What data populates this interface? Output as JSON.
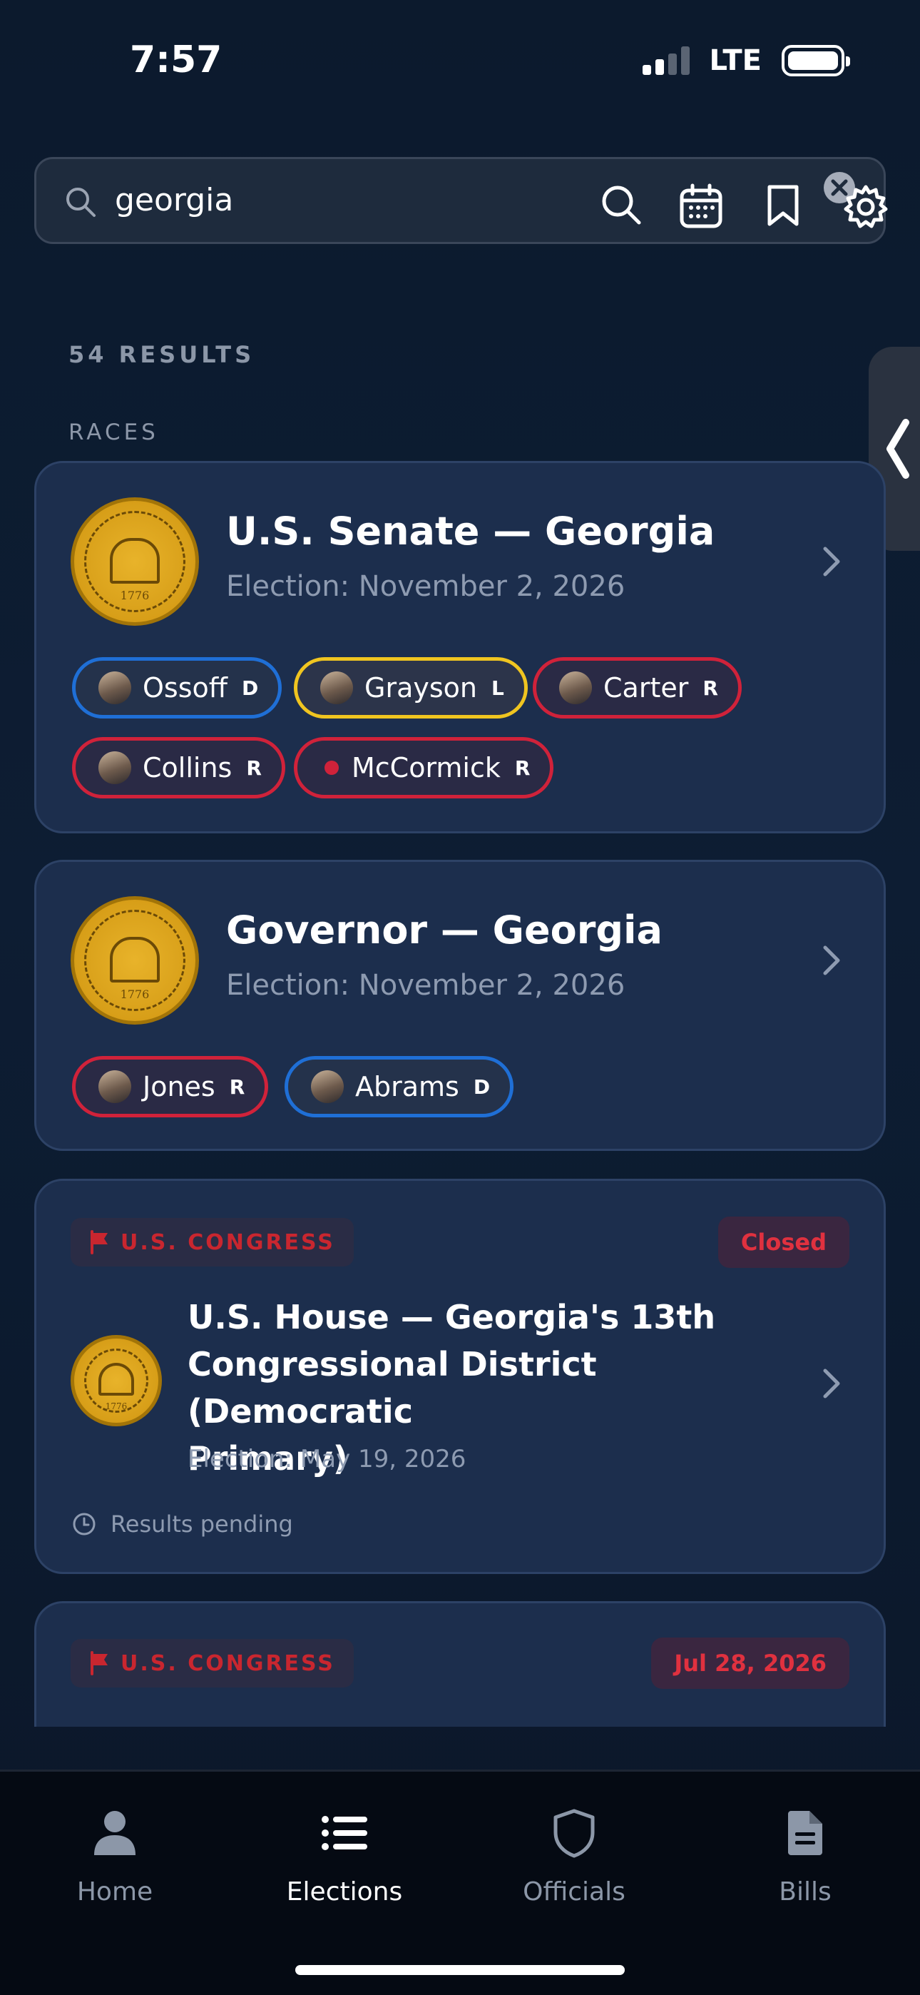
{
  "status": {
    "time": "7:57",
    "network": "LTE"
  },
  "search": {
    "value": "georgia"
  },
  "results": {
    "count_label": "54 RESULTS",
    "section_label": "RACES"
  },
  "cards": [
    {
      "title": "U.S. Senate — Georgia",
      "subtitle": "Election: November 2, 2026",
      "candidates": [
        {
          "name": "Ossoff",
          "party": "D"
        },
        {
          "name": "Grayson",
          "party": "L"
        },
        {
          "name": "Carter",
          "party": "R"
        },
        {
          "name": "Collins",
          "party": "R"
        },
        {
          "name": "McCormick",
          "party": "R"
        }
      ],
      "seal_year": "1776"
    },
    {
      "title": "Governor — Georgia",
      "subtitle": "Election: November 2, 2026",
      "candidates": [
        {
          "name": "Jones",
          "party": "R"
        },
        {
          "name": "Abrams",
          "party": "D"
        }
      ],
      "seal_year": "1776"
    },
    {
      "category": "U.S. CONGRESS",
      "badge": "Closed",
      "title_lines": [
        "U.S. House — Georgia's 13th",
        "Congressional District (Democratic",
        "Primary)"
      ],
      "subtitle": "Election: May 19, 2026",
      "status_text": "Results pending",
      "seal_year": "1776"
    },
    {
      "category": "U.S. CONGRESS",
      "badge": "Jul 28, 2026"
    }
  ],
  "tabs": [
    {
      "label": "Home",
      "icon": "person-icon"
    },
    {
      "label": "Elections",
      "icon": "list-icon"
    },
    {
      "label": "Officials",
      "icon": "shield-icon"
    },
    {
      "label": "Bills",
      "icon": "document-icon"
    }
  ],
  "colors": {
    "democrat": "#1f6fd6",
    "republican": "#d0223a",
    "libertarian": "#f0c520",
    "accent_red": "#e0313f"
  }
}
